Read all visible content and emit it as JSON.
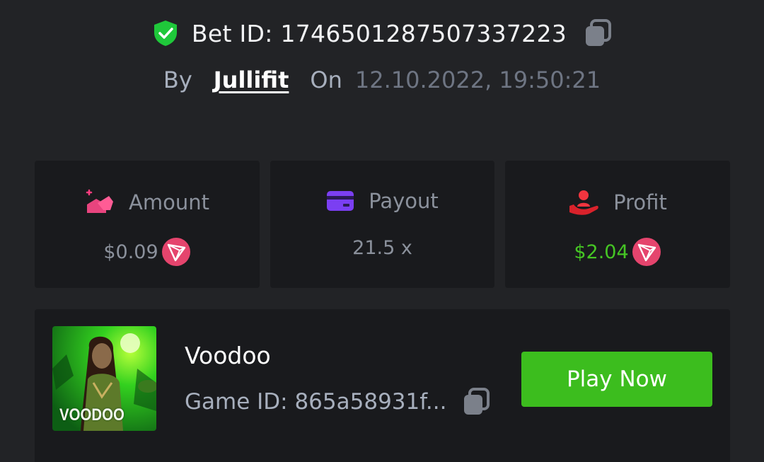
{
  "header": {
    "bet_id_text": "Bet ID: 1746501287507337223",
    "by_label": "By",
    "username": "Jullifit",
    "on_label": "On",
    "datetime": "12.10.2022, 19:50:21"
  },
  "stats": {
    "amount": {
      "label": "Amount",
      "value": "$0.09",
      "icon": "amount-icon",
      "currency_icon": "tron-icon"
    },
    "payout": {
      "label": "Payout",
      "value": "21.5 x",
      "icon": "card-icon"
    },
    "profit": {
      "label": "Profit",
      "value": "$2.04",
      "icon": "hand-user-icon",
      "currency_icon": "tron-icon"
    }
  },
  "game": {
    "name": "Voodoo",
    "game_id_text": "Game ID: 865a58931f...",
    "thumbnail_title": "VOODOO",
    "play_label": "Play Now"
  },
  "colors": {
    "background": "#222326",
    "card": "#191a1d",
    "verified_green": "#1fc83a",
    "profit_green": "#45c524",
    "play_button": "#3cbd1e",
    "tron_red": "#e5446d",
    "payout_purple": "#7b3ff2"
  }
}
